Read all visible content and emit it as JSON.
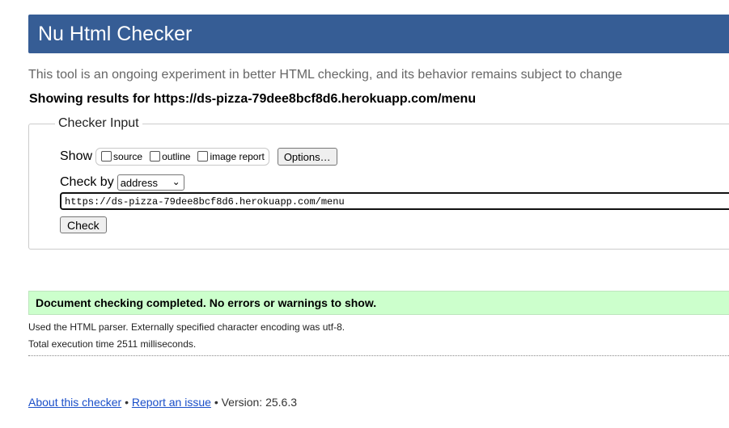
{
  "header": {
    "title": "Nu Html Checker"
  },
  "tagline": "This tool is an ongoing experiment in better HTML checking, and its behavior remains subject to change",
  "results_heading": "Showing results for https://ds-pizza-79dee8bcf8d6.herokuapp.com/menu",
  "checker_input": {
    "legend": "Checker Input",
    "show_label": "Show",
    "options": [
      {
        "label": "source",
        "checked": false
      },
      {
        "label": "outline",
        "checked": false
      },
      {
        "label": "image report",
        "checked": false
      }
    ],
    "options_button": "Options…",
    "check_by_label": "Check by",
    "check_by_selected": "address",
    "url_value": "https://ds-pizza-79dee8bcf8d6.herokuapp.com/menu",
    "check_button": "Check"
  },
  "result": {
    "success_message": "Document checking completed. No errors or warnings to show.",
    "parser_info": "Used the HTML parser. Externally specified character encoding was utf-8.",
    "execution_time": "Total execution time 2511 milliseconds."
  },
  "footer": {
    "about_link": "About this checker",
    "separator": "•",
    "report_link": "Report an issue",
    "version": "Version: 25.6.3"
  },
  "colors": {
    "banner": "#365d95",
    "success_bg": "#ccffcc",
    "link": "#1a4fc9"
  }
}
